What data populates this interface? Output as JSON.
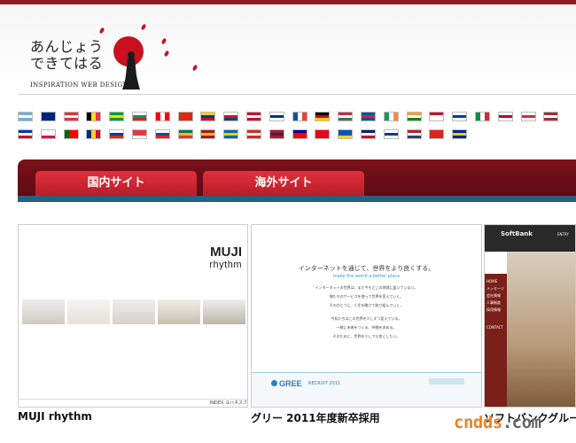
{
  "logo": {
    "line1": "あんじょう",
    "line2": "できてはる",
    "tagline": "INSPIRATION WEB DESIGN"
  },
  "flags": [
    {
      "name": "argentina",
      "colors": [
        "#74acdf",
        "#ffffff",
        "#74acdf"
      ]
    },
    {
      "name": "australia",
      "colors": [
        "#00247d",
        "#00247d",
        "#00247d"
      ]
    },
    {
      "name": "austria",
      "colors": [
        "#ed2939",
        "#ffffff",
        "#ed2939"
      ]
    },
    {
      "name": "belgium",
      "colors": [
        "#000000",
        "#fdda24",
        "#ef3340"
      ],
      "vertical": true
    },
    {
      "name": "brazil",
      "colors": [
        "#009b3a",
        "#fedf00",
        "#009b3a"
      ]
    },
    {
      "name": "bulgaria",
      "colors": [
        "#ffffff",
        "#00966e",
        "#d62612"
      ]
    },
    {
      "name": "canada",
      "colors": [
        "#ff0000",
        "#ffffff",
        "#ff0000"
      ],
      "vertical": true
    },
    {
      "name": "china",
      "colors": [
        "#de2910",
        "#de2910",
        "#de2910"
      ]
    },
    {
      "name": "colombia",
      "colors": [
        "#fcd116",
        "#003893",
        "#ce1126"
      ]
    },
    {
      "name": "czech",
      "colors": [
        "#ffffff",
        "#d7141a",
        "#11457e"
      ]
    },
    {
      "name": "denmark",
      "colors": [
        "#c8102e",
        "#ffffff",
        "#c8102e"
      ]
    },
    {
      "name": "finland",
      "colors": [
        "#ffffff",
        "#003580",
        "#ffffff"
      ]
    },
    {
      "name": "france",
      "colors": [
        "#0055a4",
        "#ffffff",
        "#ef4135"
      ],
      "vertical": true
    },
    {
      "name": "germany",
      "colors": [
        "#000000",
        "#dd0000",
        "#ffce00"
      ]
    },
    {
      "name": "hungary",
      "colors": [
        "#ce2939",
        "#ffffff",
        "#477050"
      ]
    },
    {
      "name": "iceland",
      "colors": [
        "#02529c",
        "#dc1e35",
        "#02529c"
      ]
    },
    {
      "name": "ireland",
      "colors": [
        "#169b62",
        "#ffffff",
        "#ff883e"
      ],
      "vertical": true
    },
    {
      "name": "india",
      "colors": [
        "#ff9933",
        "#ffffff",
        "#138808"
      ]
    },
    {
      "name": "indonesia",
      "colors": [
        "#ce1126",
        "#ffffff",
        "#ffffff"
      ]
    },
    {
      "name": "israel",
      "colors": [
        "#ffffff",
        "#0038b8",
        "#ffffff"
      ]
    },
    {
      "name": "italy",
      "colors": [
        "#009246",
        "#ffffff",
        "#ce2b37"
      ],
      "vertical": true
    },
    {
      "name": "japan",
      "colors": [
        "#ffffff",
        "#bc002d",
        "#ffffff"
      ]
    },
    {
      "name": "korea",
      "colors": [
        "#ffffff",
        "#cd2e3a",
        "#ffffff"
      ]
    },
    {
      "name": "latvia",
      "colors": [
        "#9e3039",
        "#ffffff",
        "#9e3039"
      ]
    },
    {
      "name": "philippines",
      "colors": [
        "#0038a8",
        "#ffffff",
        "#ce1126"
      ]
    },
    {
      "name": "poland",
      "colors": [
        "#ffffff",
        "#ffffff",
        "#dc143c"
      ]
    },
    {
      "name": "portugal",
      "colors": [
        "#006600",
        "#ff0000",
        "#ff0000"
      ],
      "vertical": true
    },
    {
      "name": "romania",
      "colors": [
        "#002b7f",
        "#fcd116",
        "#ce1126"
      ],
      "vertical": true
    },
    {
      "name": "russia",
      "colors": [
        "#ffffff",
        "#0039a6",
        "#d52b1e"
      ]
    },
    {
      "name": "singapore",
      "colors": [
        "#ef3340",
        "#ef3340",
        "#ffffff"
      ]
    },
    {
      "name": "slovakia",
      "colors": [
        "#ffffff",
        "#0b4ea2",
        "#ee1c25"
      ]
    },
    {
      "name": "south-africa",
      "colors": [
        "#007a4d",
        "#ffb612",
        "#de3831"
      ]
    },
    {
      "name": "spain",
      "colors": [
        "#aa151b",
        "#f1bf00",
        "#aa151b"
      ]
    },
    {
      "name": "sweden",
      "colors": [
        "#006aa7",
        "#fecc00",
        "#006aa7"
      ]
    },
    {
      "name": "switzerland",
      "colors": [
        "#d52b1e",
        "#ffffff",
        "#d52b1e"
      ]
    },
    {
      "name": "thailand",
      "colors": [
        "#a51931",
        "#2d2a4a",
        "#a51931"
      ]
    },
    {
      "name": "taiwan",
      "colors": [
        "#000095",
        "#fe0000",
        "#fe0000"
      ]
    },
    {
      "name": "turkey",
      "colors": [
        "#e30a17",
        "#e30a17",
        "#e30a17"
      ]
    },
    {
      "name": "ukraine",
      "colors": [
        "#0057b7",
        "#0057b7",
        "#ffd700"
      ]
    },
    {
      "name": "uk",
      "colors": [
        "#012169",
        "#ffffff",
        "#c8102e"
      ]
    },
    {
      "name": "uruguay",
      "colors": [
        "#ffffff",
        "#0038a8",
        "#ffffff"
      ]
    },
    {
      "name": "usa",
      "colors": [
        "#b22234",
        "#ffffff",
        "#3c3b6e"
      ]
    },
    {
      "name": "vietnam",
      "colors": [
        "#da251d",
        "#da251d",
        "#da251d"
      ]
    },
    {
      "name": "bosnia",
      "colors": [
        "#002395",
        "#fecb00",
        "#002395"
      ]
    }
  ],
  "tabs": {
    "domestic": "国内サイト",
    "overseas": "海外サイト"
  },
  "cards": [
    {
      "caption": "MUJI rhythm",
      "brand": "MUJI",
      "brand_sub": "rhythm",
      "footer": "INDEX  ヨハネスブ"
    },
    {
      "caption": "グリー 2011年度新卒採用",
      "headline": "インターネットを通じて、世界をより良くする。",
      "subline": "make the world a better place",
      "body": [
        "インターネットの世界は、まだ今もどこの地域に届いていない。",
        "僕たちのサービスを使って世界を変えていく。",
        "そのひとつに、人生を賭けて取り組んでいく。",
        "今私たちはこの世界を少しずつ変えている。",
        "一緒に未来をつくる、仲間を求める。",
        "そのために、世界を少しでも良くしたい。"
      ],
      "logo": "GREE",
      "logo_sub": "RECRUIT 2011"
    },
    {
      "caption": "ソフトバンクグループ",
      "brand": "SoftBank",
      "entry": "ENTRY",
      "menu": [
        "HOME",
        "メッセージ",
        "会社情報",
        "人事制度",
        "採用情報",
        "CONTACT"
      ]
    }
  ],
  "watermark": {
    "part1": "cn",
    "part2": "dds",
    "part3": ".com"
  }
}
